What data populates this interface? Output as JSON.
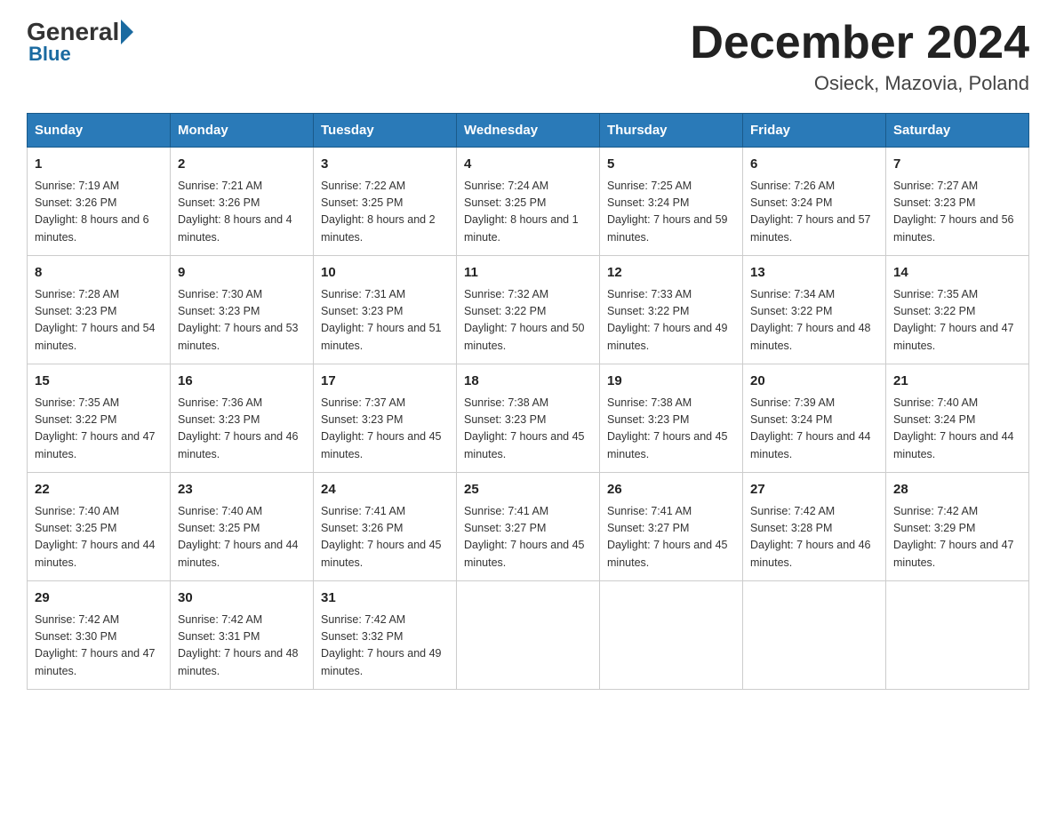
{
  "header": {
    "logo_general": "General",
    "logo_blue": "Blue",
    "month_year": "December 2024",
    "location": "Osieck, Mazovia, Poland"
  },
  "days_of_week": [
    "Sunday",
    "Monday",
    "Tuesday",
    "Wednesday",
    "Thursday",
    "Friday",
    "Saturday"
  ],
  "weeks": [
    [
      {
        "day": "1",
        "sunrise": "7:19 AM",
        "sunset": "3:26 PM",
        "daylight": "8 hours and 6 minutes."
      },
      {
        "day": "2",
        "sunrise": "7:21 AM",
        "sunset": "3:26 PM",
        "daylight": "8 hours and 4 minutes."
      },
      {
        "day": "3",
        "sunrise": "7:22 AM",
        "sunset": "3:25 PM",
        "daylight": "8 hours and 2 minutes."
      },
      {
        "day": "4",
        "sunrise": "7:24 AM",
        "sunset": "3:25 PM",
        "daylight": "8 hours and 1 minute."
      },
      {
        "day": "5",
        "sunrise": "7:25 AM",
        "sunset": "3:24 PM",
        "daylight": "7 hours and 59 minutes."
      },
      {
        "day": "6",
        "sunrise": "7:26 AM",
        "sunset": "3:24 PM",
        "daylight": "7 hours and 57 minutes."
      },
      {
        "day": "7",
        "sunrise": "7:27 AM",
        "sunset": "3:23 PM",
        "daylight": "7 hours and 56 minutes."
      }
    ],
    [
      {
        "day": "8",
        "sunrise": "7:28 AM",
        "sunset": "3:23 PM",
        "daylight": "7 hours and 54 minutes."
      },
      {
        "day": "9",
        "sunrise": "7:30 AM",
        "sunset": "3:23 PM",
        "daylight": "7 hours and 53 minutes."
      },
      {
        "day": "10",
        "sunrise": "7:31 AM",
        "sunset": "3:23 PM",
        "daylight": "7 hours and 51 minutes."
      },
      {
        "day": "11",
        "sunrise": "7:32 AM",
        "sunset": "3:22 PM",
        "daylight": "7 hours and 50 minutes."
      },
      {
        "day": "12",
        "sunrise": "7:33 AM",
        "sunset": "3:22 PM",
        "daylight": "7 hours and 49 minutes."
      },
      {
        "day": "13",
        "sunrise": "7:34 AM",
        "sunset": "3:22 PM",
        "daylight": "7 hours and 48 minutes."
      },
      {
        "day": "14",
        "sunrise": "7:35 AM",
        "sunset": "3:22 PM",
        "daylight": "7 hours and 47 minutes."
      }
    ],
    [
      {
        "day": "15",
        "sunrise": "7:35 AM",
        "sunset": "3:22 PM",
        "daylight": "7 hours and 47 minutes."
      },
      {
        "day": "16",
        "sunrise": "7:36 AM",
        "sunset": "3:23 PM",
        "daylight": "7 hours and 46 minutes."
      },
      {
        "day": "17",
        "sunrise": "7:37 AM",
        "sunset": "3:23 PM",
        "daylight": "7 hours and 45 minutes."
      },
      {
        "day": "18",
        "sunrise": "7:38 AM",
        "sunset": "3:23 PM",
        "daylight": "7 hours and 45 minutes."
      },
      {
        "day": "19",
        "sunrise": "7:38 AM",
        "sunset": "3:23 PM",
        "daylight": "7 hours and 45 minutes."
      },
      {
        "day": "20",
        "sunrise": "7:39 AM",
        "sunset": "3:24 PM",
        "daylight": "7 hours and 44 minutes."
      },
      {
        "day": "21",
        "sunrise": "7:40 AM",
        "sunset": "3:24 PM",
        "daylight": "7 hours and 44 minutes."
      }
    ],
    [
      {
        "day": "22",
        "sunrise": "7:40 AM",
        "sunset": "3:25 PM",
        "daylight": "7 hours and 44 minutes."
      },
      {
        "day": "23",
        "sunrise": "7:40 AM",
        "sunset": "3:25 PM",
        "daylight": "7 hours and 44 minutes."
      },
      {
        "day": "24",
        "sunrise": "7:41 AM",
        "sunset": "3:26 PM",
        "daylight": "7 hours and 45 minutes."
      },
      {
        "day": "25",
        "sunrise": "7:41 AM",
        "sunset": "3:27 PM",
        "daylight": "7 hours and 45 minutes."
      },
      {
        "day": "26",
        "sunrise": "7:41 AM",
        "sunset": "3:27 PM",
        "daylight": "7 hours and 45 minutes."
      },
      {
        "day": "27",
        "sunrise": "7:42 AM",
        "sunset": "3:28 PM",
        "daylight": "7 hours and 46 minutes."
      },
      {
        "day": "28",
        "sunrise": "7:42 AM",
        "sunset": "3:29 PM",
        "daylight": "7 hours and 47 minutes."
      }
    ],
    [
      {
        "day": "29",
        "sunrise": "7:42 AM",
        "sunset": "3:30 PM",
        "daylight": "7 hours and 47 minutes."
      },
      {
        "day": "30",
        "sunrise": "7:42 AM",
        "sunset": "3:31 PM",
        "daylight": "7 hours and 48 minutes."
      },
      {
        "day": "31",
        "sunrise": "7:42 AM",
        "sunset": "3:32 PM",
        "daylight": "7 hours and 49 minutes."
      },
      null,
      null,
      null,
      null
    ]
  ]
}
